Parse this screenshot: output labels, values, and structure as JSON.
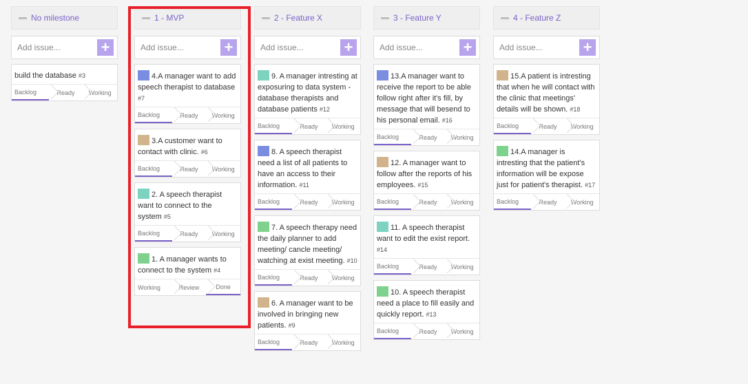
{
  "add_issue_placeholder": "Add issue...",
  "add_icon": "+",
  "columns": [
    {
      "title": "No milestone",
      "cards": [
        {
          "text": "build the database",
          "num": "#3",
          "steps": [
            "Backlog",
            "Ready",
            "Working"
          ]
        }
      ]
    },
    {
      "title": "1 - MVP",
      "cards": [
        {
          "text": "4.A manager want to add speech therapist to database",
          "num": "#7",
          "steps": [
            "Backlog",
            "Ready",
            "Working"
          ]
        },
        {
          "text": "3.A customer want to contact with clinic.",
          "num": "#6",
          "steps": [
            "Backlog",
            "Ready",
            "Working"
          ]
        },
        {
          "text": "2. A speech therapist want to connect to the system",
          "num": "#5",
          "steps": [
            "Backlog",
            "Ready",
            "Working"
          ]
        },
        {
          "text": "1. A manager wants to connect to the system",
          "num": "#4",
          "steps": [
            "Working",
            "Review",
            "Done"
          ]
        }
      ]
    },
    {
      "title": "2 - Feature X",
      "cards": [
        {
          "text": "9. A manager intresting at exposuring to data system - database therapists and database patients",
          "num": "#12",
          "steps": [
            "Backlog",
            "Ready",
            "Working"
          ]
        },
        {
          "text": "8. A speech therapist need a list of all patients to have an access to their information.",
          "num": "#11",
          "steps": [
            "Backlog",
            "Ready",
            "Working"
          ]
        },
        {
          "text": "7. A speech therapy need the daily planner to add meeting/ cancle meeting/ watching at exist meeting.",
          "num": "#10",
          "steps": [
            "Backlog",
            "Ready",
            "Working"
          ]
        },
        {
          "text": "6. A manager want to be involved in bringing new patients.",
          "num": "#9",
          "steps": [
            "Backlog",
            "Ready",
            "Working"
          ]
        }
      ]
    },
    {
      "title": "3 - Feature Y",
      "cards": [
        {
          "text": "13.A manager want to receive the report to be able follow right after it's fill, by message that will besend to his personal email.",
          "num": "#16",
          "steps": [
            "Backlog",
            "Ready",
            "Working"
          ]
        },
        {
          "text": "12. A manager want to follow after the reports of his employees.",
          "num": "#15",
          "steps": [
            "Backlog",
            "Ready",
            "Working"
          ]
        },
        {
          "text": "11. A speech therapist want to edit the exist report.",
          "num": "#14",
          "steps": [
            "Backlog",
            "Ready",
            "Working"
          ]
        },
        {
          "text": "10. A speech therapist need a place to fill easily and quickly report.",
          "num": "#13",
          "steps": [
            "Backlog",
            "Ready",
            "Working"
          ]
        }
      ]
    },
    {
      "title": "4 - Feature Z",
      "cards": [
        {
          "text": "15.A patient is intresting that when he will contact with the clinic that meetings' details will be shown.",
          "num": "#18",
          "steps": [
            "Backlog",
            "Ready",
            "Working"
          ]
        },
        {
          "text": "14.A manager is intresting that the patient's information will be expose just for patient's therapist.",
          "num": "#17",
          "steps": [
            "Backlog",
            "Ready",
            "Working"
          ]
        }
      ]
    }
  ]
}
